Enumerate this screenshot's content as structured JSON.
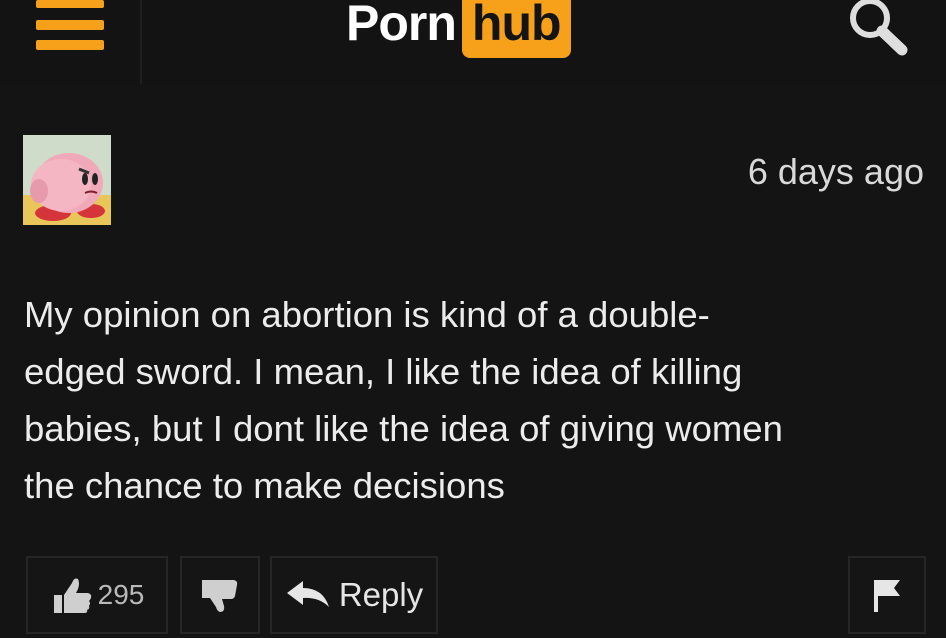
{
  "header": {
    "logo_left": "Porn",
    "logo_right": "hub",
    "menu_icon": "hamburger-menu-icon",
    "search_icon": "search-icon"
  },
  "comment": {
    "avatar_icon": "avatar",
    "timestamp": "6 days ago",
    "lines": [
      "My opinion on abortion is kind of a double-",
      "edged sword. I mean, I like the idea of killing",
      "babies, but I dont like the idea of giving women",
      "the chance to make decisions"
    ]
  },
  "actions": {
    "like_count": "295",
    "reply_label": "Reply",
    "like_icon": "thumbs-up-icon",
    "dislike_icon": "thumbs-down-icon",
    "reply_icon": "reply-arrow-icon",
    "flag_icon": "flag-icon"
  },
  "colors": {
    "background": "#141414",
    "accent": "#f7a11a",
    "text": "#ececec"
  }
}
